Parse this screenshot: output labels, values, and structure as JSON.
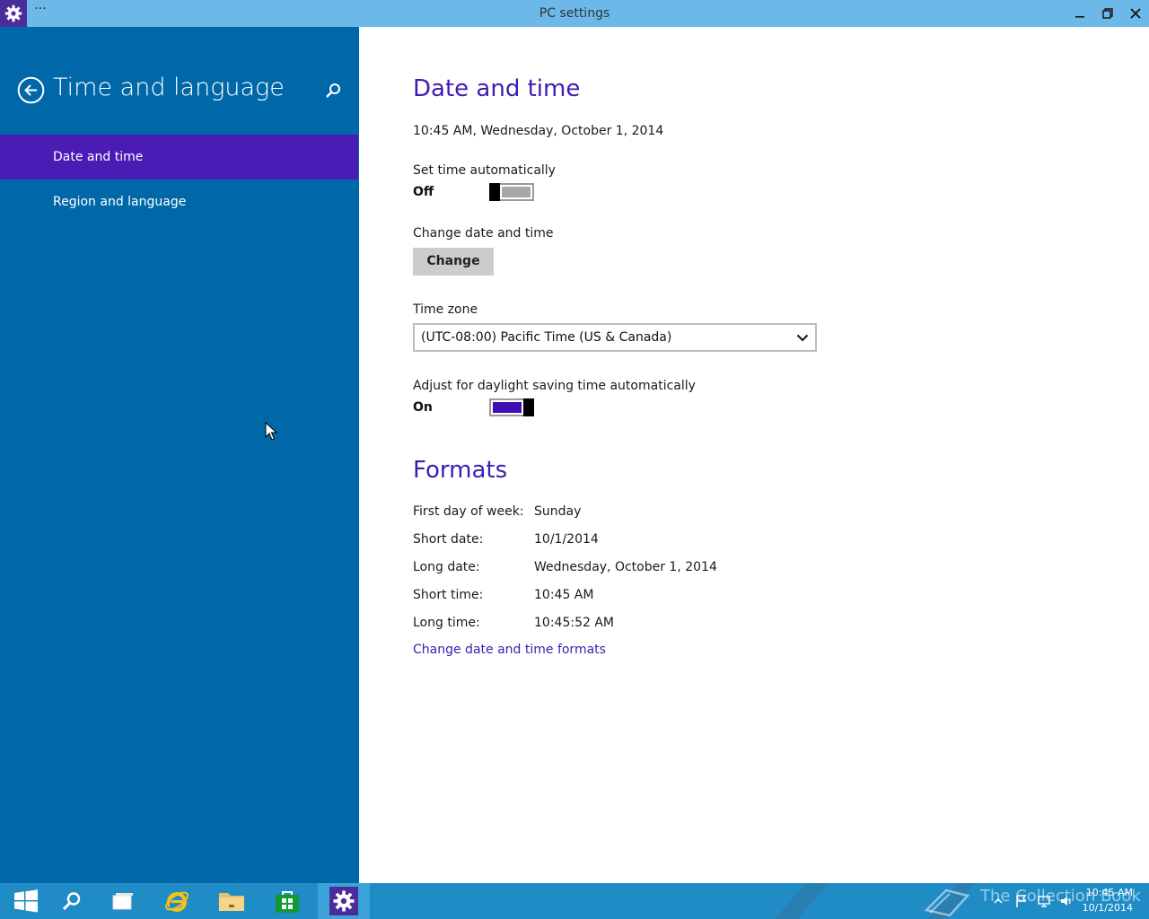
{
  "window": {
    "title": "PC settings",
    "menu_label": "···"
  },
  "sidebar": {
    "title": "Time and language",
    "items": [
      {
        "label": "Date and time",
        "selected": true
      },
      {
        "label": "Region and language",
        "selected": false
      }
    ]
  },
  "main": {
    "heading": "Date and time",
    "current_datetime": "10:45 AM, Wednesday, October 1, 2014",
    "set_time_auto": {
      "label": "Set time automatically",
      "state": "Off"
    },
    "change_datetime": {
      "label": "Change date and time",
      "button": "Change"
    },
    "time_zone": {
      "label": "Time zone",
      "value": "(UTC-08:00) Pacific Time (US & Canada)"
    },
    "dst": {
      "label": "Adjust for daylight saving time automatically",
      "state": "On"
    },
    "formats": {
      "heading": "Formats",
      "rows": [
        {
          "label": "First day of week:",
          "value": "Sunday"
        },
        {
          "label": "Short date:",
          "value": "10/1/2014"
        },
        {
          "label": "Long date:",
          "value": "Wednesday, October 1, 2014"
        },
        {
          "label": "Short time:",
          "value": "10:45 AM"
        },
        {
          "label": "Long time:",
          "value": "10:45:52 AM"
        }
      ],
      "link": "Change date and time formats"
    }
  },
  "taskbar": {
    "apps": [
      "start-icon",
      "search-icon",
      "task-view-icon",
      "internet-explorer-icon",
      "file-explorer-icon",
      "store-icon",
      "settings-icon"
    ],
    "watermark": "The Collection Book",
    "clock_time": "10:45 AM",
    "clock_date": "10/1/2014"
  },
  "colors": {
    "accent": "#3d1cb2",
    "sidebar": "#0068a8",
    "selected_item": "#4b1bb5",
    "titlebar": "#6cb9e9",
    "taskbar": "#1f8cc6"
  }
}
